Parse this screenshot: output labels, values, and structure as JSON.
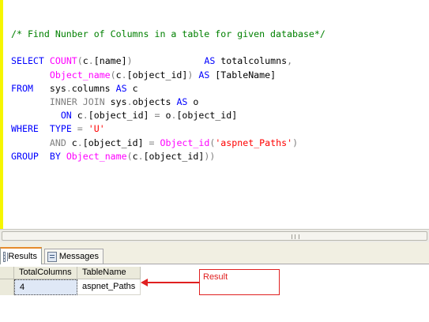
{
  "editor": {
    "lines": [
      [
        {
          "t": "/* Find Nunber of Columns in a table for given database*/",
          "c": "cm"
        }
      ],
      [],
      [
        {
          "t": "SELECT ",
          "c": "kw"
        },
        {
          "t": "COUNT",
          "c": "fn"
        },
        {
          "t": "(",
          "c": "op"
        },
        {
          "t": "c",
          "c": ""
        },
        {
          "t": ".",
          "c": "op"
        },
        {
          "t": "[name]",
          "c": ""
        },
        {
          "t": ")",
          "c": "op"
        },
        {
          "t": "             ",
          "c": ""
        },
        {
          "t": "AS",
          "c": "kw"
        },
        {
          "t": " totalcolumns",
          "c": ""
        },
        {
          "t": ",",
          "c": "op"
        }
      ],
      [
        {
          "t": "       ",
          "c": ""
        },
        {
          "t": "Object_name",
          "c": "fn"
        },
        {
          "t": "(",
          "c": "op"
        },
        {
          "t": "c",
          "c": ""
        },
        {
          "t": ".",
          "c": "op"
        },
        {
          "t": "[object_id]",
          "c": ""
        },
        {
          "t": ")",
          "c": "op"
        },
        {
          "t": " ",
          "c": ""
        },
        {
          "t": "AS",
          "c": "kw"
        },
        {
          "t": " [TableName]",
          "c": ""
        }
      ],
      [
        {
          "t": "FROM",
          "c": "kw"
        },
        {
          "t": "   sys",
          "c": ""
        },
        {
          "t": ".",
          "c": "op"
        },
        {
          "t": "columns ",
          "c": ""
        },
        {
          "t": "AS",
          "c": "kw"
        },
        {
          "t": " c",
          "c": ""
        }
      ],
      [
        {
          "t": "       ",
          "c": ""
        },
        {
          "t": "INNER JOIN",
          "c": "op"
        },
        {
          "t": " sys",
          "c": ""
        },
        {
          "t": ".",
          "c": "op"
        },
        {
          "t": "objects ",
          "c": ""
        },
        {
          "t": "AS",
          "c": "kw"
        },
        {
          "t": " o",
          "c": ""
        }
      ],
      [
        {
          "t": "         ",
          "c": ""
        },
        {
          "t": "ON",
          "c": "kw"
        },
        {
          "t": " c",
          "c": ""
        },
        {
          "t": ".",
          "c": "op"
        },
        {
          "t": "[object_id] ",
          "c": ""
        },
        {
          "t": "=",
          "c": "op"
        },
        {
          "t": " o",
          "c": ""
        },
        {
          "t": ".",
          "c": "op"
        },
        {
          "t": "[object_id]",
          "c": ""
        }
      ],
      [
        {
          "t": "WHERE",
          "c": "kw"
        },
        {
          "t": "  ",
          "c": ""
        },
        {
          "t": "TYPE",
          "c": "kw"
        },
        {
          "t": " ",
          "c": ""
        },
        {
          "t": "=",
          "c": "op"
        },
        {
          "t": " ",
          "c": ""
        },
        {
          "t": "'U'",
          "c": "str"
        }
      ],
      [
        {
          "t": "       ",
          "c": ""
        },
        {
          "t": "AND",
          "c": "op"
        },
        {
          "t": " c",
          "c": ""
        },
        {
          "t": ".",
          "c": "op"
        },
        {
          "t": "[object_id] ",
          "c": ""
        },
        {
          "t": "=",
          "c": "op"
        },
        {
          "t": " ",
          "c": ""
        },
        {
          "t": "Object_id",
          "c": "fn"
        },
        {
          "t": "(",
          "c": "op"
        },
        {
          "t": "'aspnet_Paths'",
          "c": "str"
        },
        {
          "t": ")",
          "c": "op"
        }
      ],
      [
        {
          "t": "GROUP",
          "c": "kw"
        },
        {
          "t": "  ",
          "c": ""
        },
        {
          "t": "BY",
          "c": "kw"
        },
        {
          "t": " ",
          "c": ""
        },
        {
          "t": "Object_name",
          "c": "fn"
        },
        {
          "t": "(",
          "c": "op"
        },
        {
          "t": "c",
          "c": ""
        },
        {
          "t": ".",
          "c": "op"
        },
        {
          "t": "[object_id]",
          "c": ""
        },
        {
          "t": "))",
          "c": "op"
        }
      ]
    ]
  },
  "tabs": {
    "results_label": "Results",
    "messages_label": "Messages",
    "results_icon": "results-grid-icon",
    "messages_icon": "messages-icon"
  },
  "grid": {
    "columns": [
      "TotalColumns",
      "TableName"
    ],
    "rows": [
      [
        "4",
        "aspnet_Paths"
      ]
    ]
  },
  "annotation": {
    "label": "Result",
    "color": "#e02020"
  }
}
